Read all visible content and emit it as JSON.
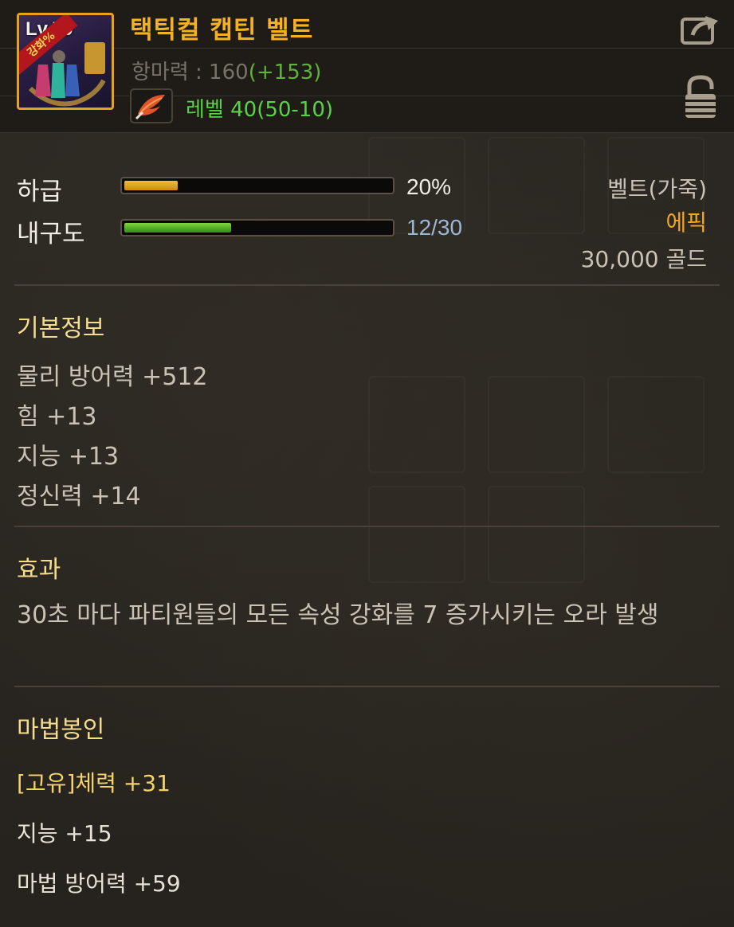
{
  "header": {
    "icon": {
      "level_badge": "Lv.50",
      "ribbon_text": "강화%",
      "name": "belt-item-icon"
    },
    "item_name": "택틱컬 캡틴 벨트",
    "resist_label": "항마력 : 160",
    "resist_bonus": "(+153)",
    "level_requirement": "레벨 40(50-10)",
    "icons": [
      "share-icon",
      "lock-icon",
      "feather-icon"
    ]
  },
  "grade": {
    "label": "하급",
    "value_text": "20%",
    "fill_fraction": 0.2
  },
  "durability": {
    "label": "내구도",
    "value_text": "12/30",
    "fill_fraction": 0.4
  },
  "info": {
    "type": "벨트(가죽)",
    "rarity": "에픽",
    "price": "30,000 골드"
  },
  "basic": {
    "title": "기본정보",
    "stats": [
      "물리 방어력 +512",
      "힘 +13",
      "지능 +13",
      "정신력 +14"
    ]
  },
  "effect": {
    "title": "효과",
    "text": "30초 마다 파티원들의 모든 속성 강화를 7 증가시키는 오라 발생"
  },
  "magic_seal": {
    "title": "마법봉인",
    "unique": "[고유]체력 +31",
    "stats": [
      "지능 +15",
      "마법 방어력 +59"
    ]
  },
  "colors": {
    "item_name": "#f5b21f",
    "rarity_epic": "#f5a623",
    "level_green": "#5bd14a",
    "section_title": "#f6dc8e"
  }
}
